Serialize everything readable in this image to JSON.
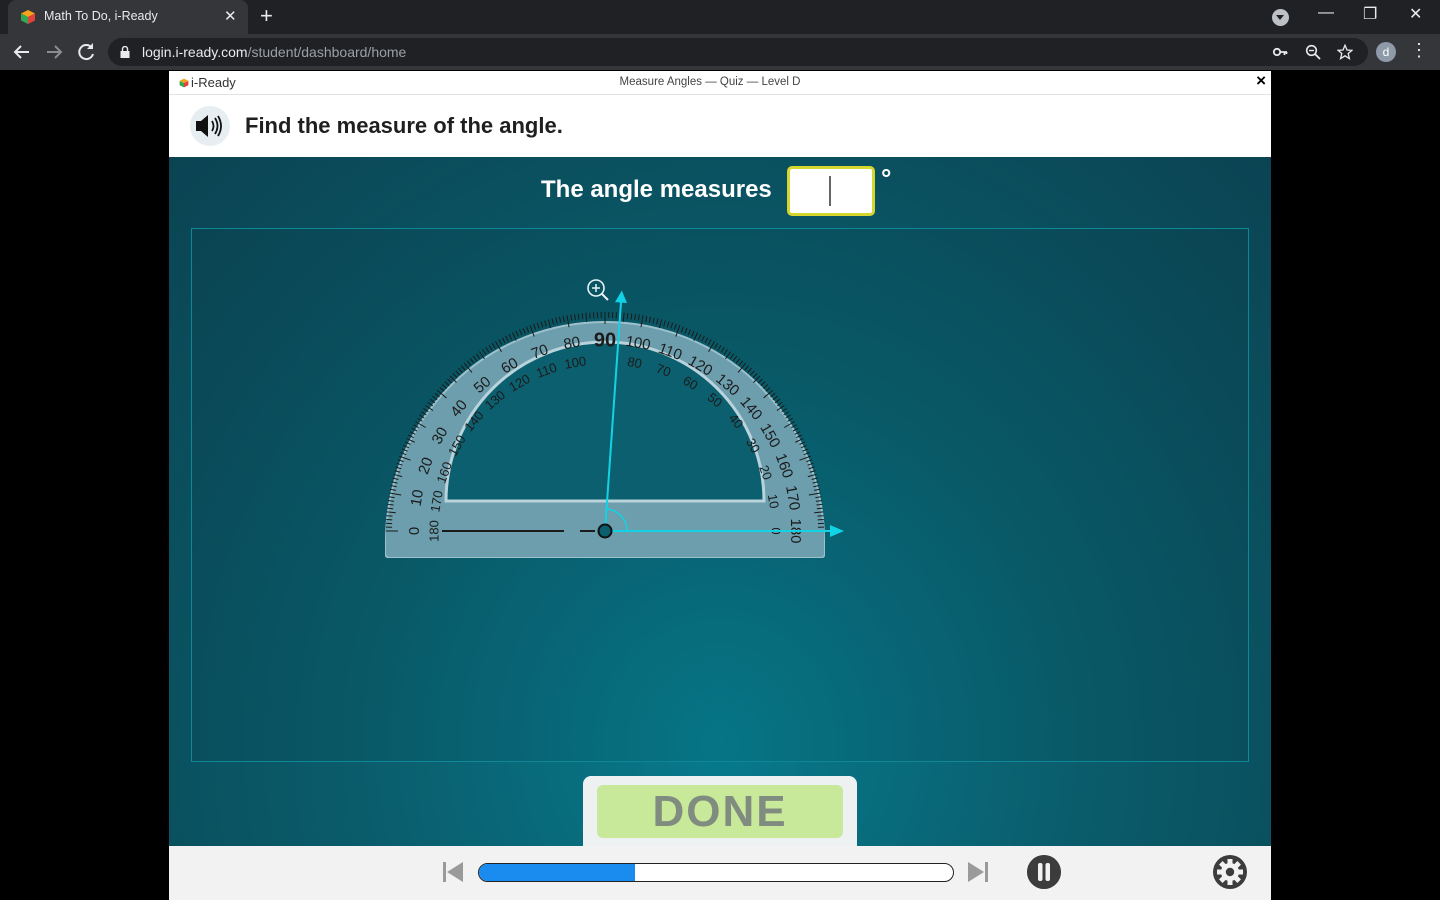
{
  "browser": {
    "tab_title": "Math To Do, i-Ready",
    "tab_close": "✕",
    "new_tab": "+",
    "url_host": "login.i-ready.com",
    "url_path": "/student/dashboard/home",
    "profile_initial": "d",
    "window_controls": {
      "minimize": "—",
      "restore": "❐",
      "close": "✕"
    }
  },
  "app": {
    "brand": "i-Ready",
    "lesson_title": "Measure Angles — Quiz — Level D",
    "close": "×",
    "question": "Find the measure of the angle.",
    "answer_label": "The angle measures",
    "answer_value": "",
    "degree_symbol": "°",
    "done_label": "DONE",
    "progress": 0.33
  },
  "protractor": {
    "outer_labels": [
      0,
      10,
      20,
      30,
      40,
      50,
      60,
      70,
      80,
      90,
      100,
      110,
      120,
      130,
      140,
      150,
      160,
      170,
      180
    ],
    "inner_labels": [
      180,
      170,
      160,
      150,
      140,
      130,
      120,
      110,
      100,
      80,
      70,
      60,
      50,
      40,
      30,
      20,
      10,
      0
    ],
    "ray_angle_deg": 86,
    "zoom_icon": "magnify-plus-icon"
  },
  "colors": {
    "accent_ray": "#12d3e6",
    "done_bg": "#c8e89a",
    "progress_fill": "#1a8cf0",
    "answer_border": "#d6d630"
  }
}
